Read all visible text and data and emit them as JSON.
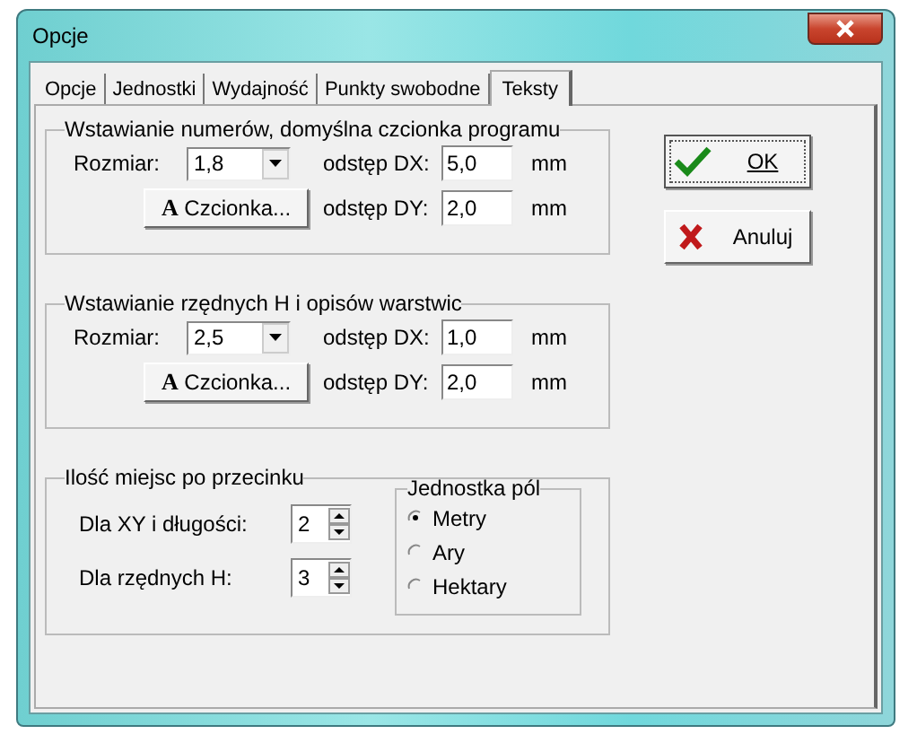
{
  "window": {
    "title": "Opcje"
  },
  "tabs": [
    {
      "label": "Opcje",
      "selected": false
    },
    {
      "label": "Jednostki",
      "selected": false
    },
    {
      "label": "Wydajność",
      "selected": false
    },
    {
      "label": "Punkty swobodne",
      "selected": false
    },
    {
      "label": "Teksty",
      "selected": true
    }
  ],
  "font_groups": [
    {
      "title": "Wstawianie numerów, domyślna czcionka programu",
      "size_label": "Rozmiar:",
      "size_value": "1,8",
      "dx_label": "odstęp DX:",
      "dx_value": "5,0",
      "dx_unit": "mm",
      "font_icon": "A",
      "font_button": "Czcionka...",
      "dy_label": "odstęp DY:",
      "dy_value": "2,0",
      "dy_unit": "mm"
    },
    {
      "title": "Wstawianie rzędnych H i opisów warstwic",
      "size_label": "Rozmiar:",
      "size_value": "2,5",
      "dx_label": "odstęp DX:",
      "dx_value": "1,0",
      "dx_unit": "mm",
      "font_icon": "A",
      "font_button": "Czcionka...",
      "dy_label": "odstęp DY:",
      "dy_value": "2,0",
      "dy_unit": "mm"
    }
  ],
  "decimals": {
    "title": "Ilość miejsc po przecinku",
    "rows": [
      {
        "label": "Dla XY i długości:",
        "value": "2"
      },
      {
        "label": "Dla rzędnych H:",
        "value": "3"
      }
    ],
    "unit_group": {
      "title": "Jednostka pól",
      "options": [
        {
          "label": "Metry",
          "selected": true
        },
        {
          "label": "Ary",
          "selected": false
        },
        {
          "label": "Hektary",
          "selected": false
        }
      ]
    }
  },
  "buttons": [
    {
      "label": "OK",
      "kind": "ok"
    },
    {
      "label": "Anuluj",
      "kind": "cancel"
    }
  ]
}
